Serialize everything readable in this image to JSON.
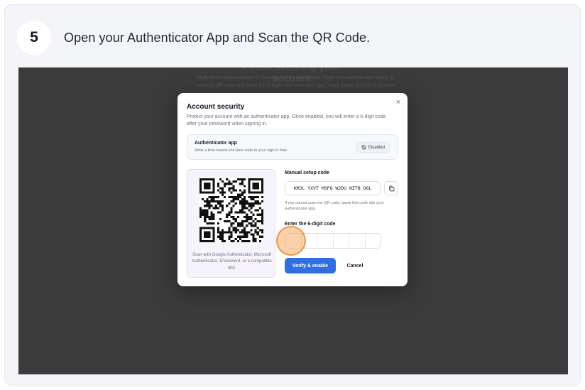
{
  "step": {
    "number": "5",
    "title": "Open your Authenticator App and Scan the QR Code."
  },
  "background_page": {
    "heading": "Finish securing your account",
    "lines": [
      "Multi-factor authentication is required for this workspace. Open the authenticator dialog to",
      "scan the QR code and enter the 6-digit code from your app. You'll regain access to account"
    ]
  },
  "dialog": {
    "close_label": "×",
    "title": "Account security",
    "description": "Protect your account with an authenticator app. Once enabled, you will enter a 6-digit code after your password when signing in.",
    "authenticator": {
      "title": "Authenticator app",
      "subtitle": "Adds a time-based one-time code to your sign-in flow.",
      "status": "Disabled"
    },
    "qr_caption": "Scan with Google Authenticator, Microsoft Authenticator, 1Password, or a compatible app.",
    "manual": {
      "label": "Manual setup code",
      "code": "KMJL YXVT MSPQ W2DU NZTB O6L",
      "help": "If you cannot scan the QR code, paste this code into your authenticator app."
    },
    "code_entry": {
      "label": "Enter the 6-digit code",
      "digits": [
        "",
        "",
        "",
        "",
        "",
        ""
      ]
    },
    "verify_label": "Verify & enable",
    "cancel_label": "Cancel"
  },
  "colors": {
    "primary": "#2f6fe0",
    "overlay": "#3b3b3b",
    "qr_panel": "#f7f3fc",
    "click_marker": "#f6ab60"
  },
  "icons": {
    "status": "shield-off-icon",
    "copy": "copy-icon",
    "close": "close-icon"
  }
}
